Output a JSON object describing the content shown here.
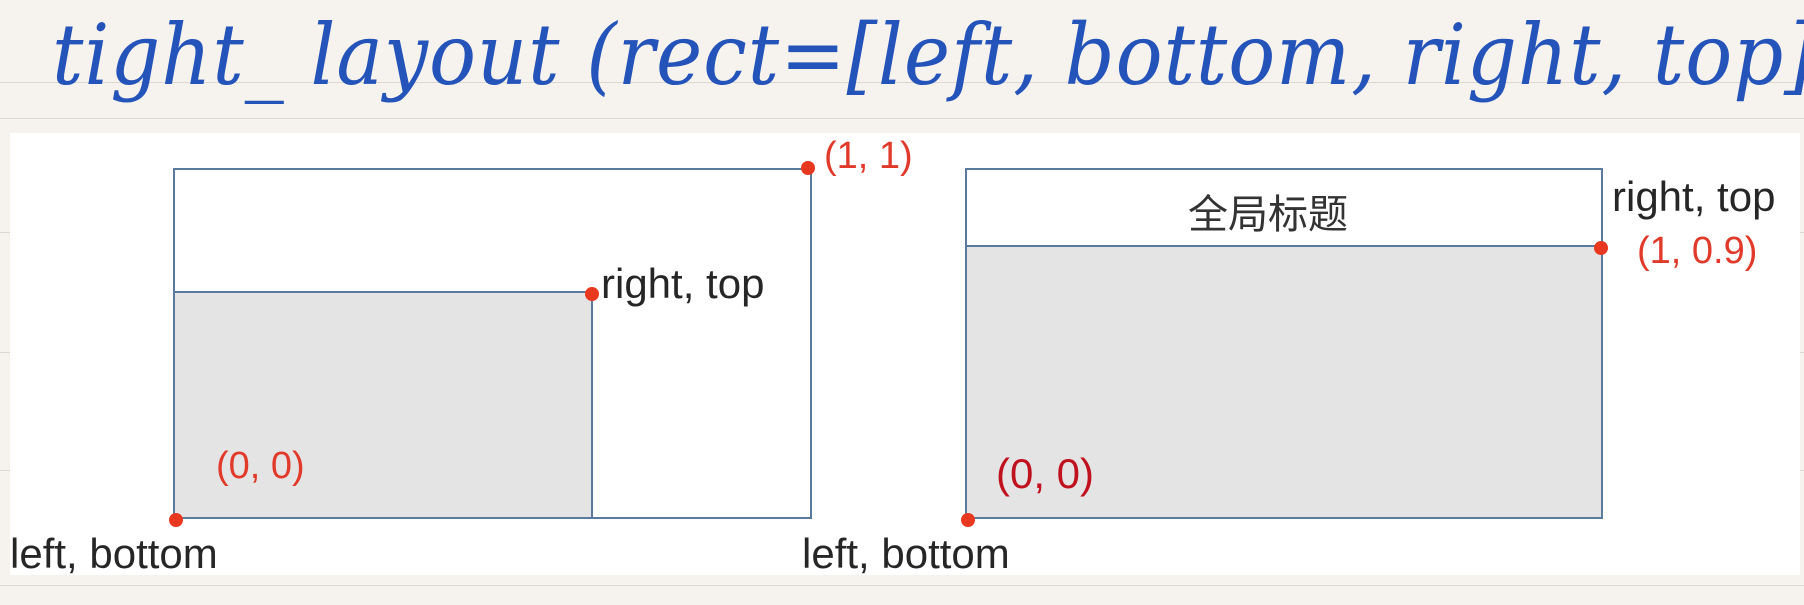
{
  "header": {
    "handwritten_text": "tight_ layout (rect=[left, bottom, right, top])"
  },
  "left_diagram": {
    "coord_top_right": "(1, 1)",
    "inner_corner_label": "right, top",
    "origin_coord": "(0, 0)",
    "origin_label": "left, bottom"
  },
  "right_diagram": {
    "title_box_text": "全局标题",
    "corner_label": "right, top",
    "corner_coord": "(1, 0.9)",
    "origin_coord": "(0, 0)",
    "origin_label": "left, bottom"
  },
  "colors": {
    "ink": "#2453b9",
    "frame": "#5b7b9e",
    "fill": "#e4e4e4",
    "point": "#e8381f"
  }
}
